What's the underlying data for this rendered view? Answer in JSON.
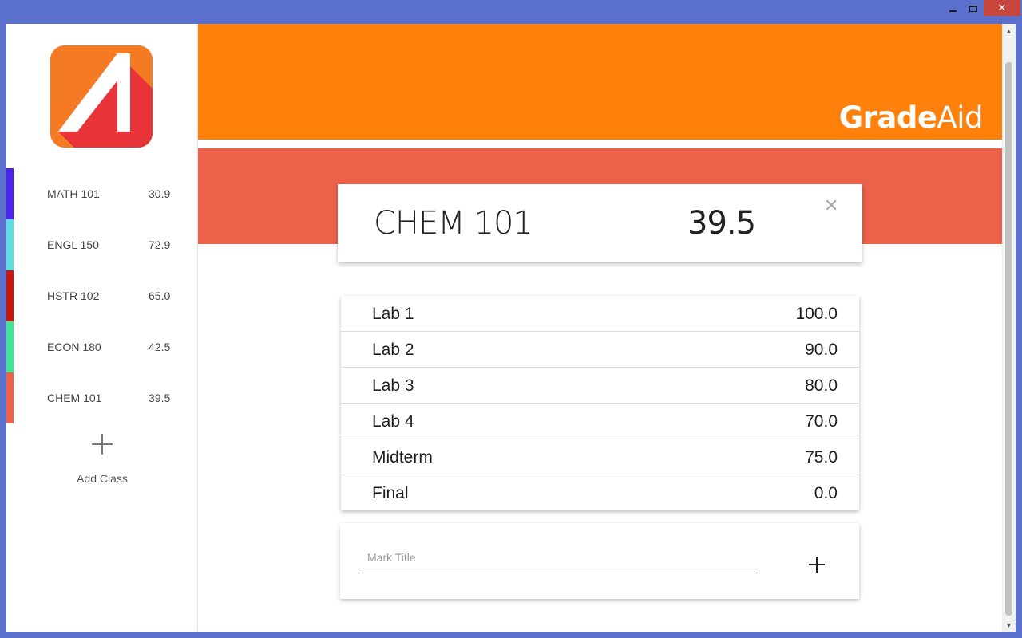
{
  "app": {
    "brand_bold": "Grade",
    "brand_light": "Aid"
  },
  "colors": {
    "window_frame": "#5b6fcc",
    "header": "#ff800b",
    "band": "#ec614a",
    "close_button": "#c7453a"
  },
  "sidebar": {
    "classes": [
      {
        "name": "MATH 101",
        "grade": "30.9",
        "color": "#4c24ee"
      },
      {
        "name": "ENGL 150",
        "grade": "72.9",
        "color": "#5bdfe0"
      },
      {
        "name": "HSTR 102",
        "grade": "65.0",
        "color": "#cc160d"
      },
      {
        "name": "ECON 180",
        "grade": "42.5",
        "color": "#3ee594"
      },
      {
        "name": "CHEM 101",
        "grade": "39.5",
        "color": "#ec614a"
      }
    ],
    "add_class_label": "Add Class"
  },
  "selected_class": {
    "name": "CHEM 101",
    "grade": "39.5"
  },
  "marks": [
    {
      "title": "Lab 1",
      "value": "100.0"
    },
    {
      "title": "Lab 2",
      "value": "90.0"
    },
    {
      "title": "Lab 3",
      "value": "80.0"
    },
    {
      "title": "Lab 4",
      "value": "70.0"
    },
    {
      "title": "Midterm",
      "value": "75.0"
    },
    {
      "title": "Final",
      "value": "0.0"
    }
  ],
  "new_mark": {
    "placeholder": "Mark Title",
    "value": ""
  }
}
